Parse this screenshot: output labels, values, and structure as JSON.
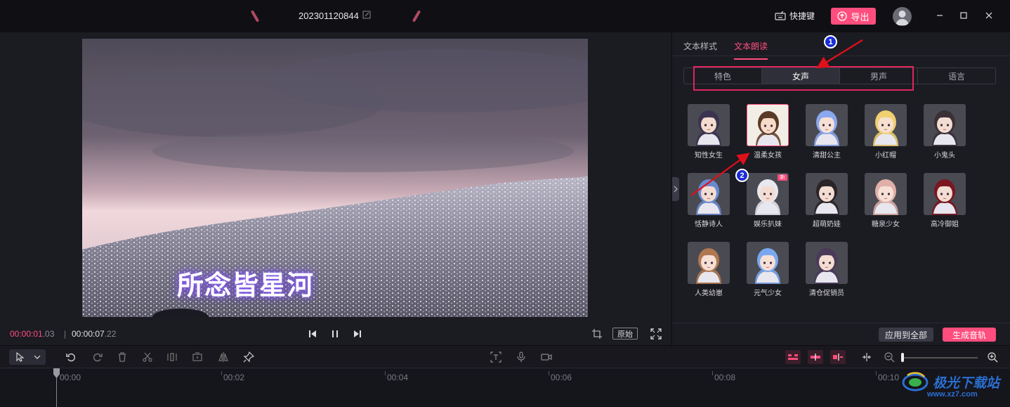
{
  "header": {
    "project_title": "202301120844",
    "shortcut_label": "快捷键",
    "export_label": "导出"
  },
  "preview": {
    "subtitle_text": "所念皆星河",
    "current_time_main": "00:00:01",
    "current_time_ms": ".03",
    "separator": "|",
    "total_time_main": "00:00:07",
    "total_time_ms": ".22",
    "original_label": "原始"
  },
  "panel": {
    "tabs": [
      {
        "label": "文本样式",
        "active": false
      },
      {
        "label": "文本朗读",
        "active": true
      }
    ],
    "categories": [
      {
        "label": "特色",
        "active": false
      },
      {
        "label": "女声",
        "active": true
      },
      {
        "label": "男声",
        "active": false
      },
      {
        "label": "语言",
        "active": false
      }
    ],
    "voices": [
      {
        "name": "知性女生",
        "hair": "#3b3350",
        "skin": "#f3dccf",
        "bg": "#4a4a52"
      },
      {
        "name": "温柔女孩",
        "hair": "#5a3a26",
        "skin": "#f6dcc8",
        "bg": "#f2eee6",
        "selected": true
      },
      {
        "name": "清甜公主",
        "hair": "#8aa8f0",
        "skin": "#f6e0d6",
        "bg": "#4a4a52"
      },
      {
        "name": "小红帽",
        "hair": "#f0d070",
        "skin": "#f6e0d0",
        "bg": "#4a4a52"
      },
      {
        "name": "小鬼头",
        "hair": "#3a3036",
        "skin": "#f3dcd2",
        "bg": "#4a4a52"
      },
      {
        "name": "恬静诗人",
        "hair": "#6a8ad0",
        "skin": "#f3dcd2",
        "bg": "#4a4a52"
      },
      {
        "name": "娱乐扒妹",
        "hair": "#e8e8ee",
        "skin": "#f3dcd2",
        "bg": "#4a4a52",
        "badge": "新"
      },
      {
        "name": "超萌奶娃",
        "hair": "#2a2428",
        "skin": "#f3dcd2",
        "bg": "#4a4a52"
      },
      {
        "name": "糖泉少女",
        "hair": "#e0b0a8",
        "skin": "#f6e0d6",
        "bg": "#4a4a52"
      },
      {
        "name": "高冷御姐",
        "hair": "#7a1620",
        "skin": "#f3dcd2",
        "bg": "#4a4a52"
      },
      {
        "name": "人类幼崽",
        "hair": "#b07850",
        "skin": "#f6e0d6",
        "bg": "#4a4a52"
      },
      {
        "name": "元气少女",
        "hair": "#7aa8f0",
        "skin": "#f6e0d6",
        "bg": "#4a4a52"
      },
      {
        "name": "清仓促销员",
        "hair": "#4a3a5a",
        "skin": "#f3dcd2",
        "bg": "#4a4a52"
      }
    ],
    "apply_all_label": "应用到全部",
    "generate_label": "生成音轨"
  },
  "annotations": {
    "marker_1": "1",
    "marker_2": "2"
  },
  "timeline": {
    "ticks": [
      "00:00",
      "00:02",
      "00:04",
      "00:06",
      "00:08",
      "00:10"
    ],
    "zoom_level": 0.0
  },
  "watermark": {
    "title": "极光下载站",
    "url": "www.xz7.com"
  },
  "colors": {
    "accent": "#ff4d7d",
    "highlight_box": "#e0245e",
    "arrow": "#e0101a",
    "marker": "#1a2bd6"
  }
}
